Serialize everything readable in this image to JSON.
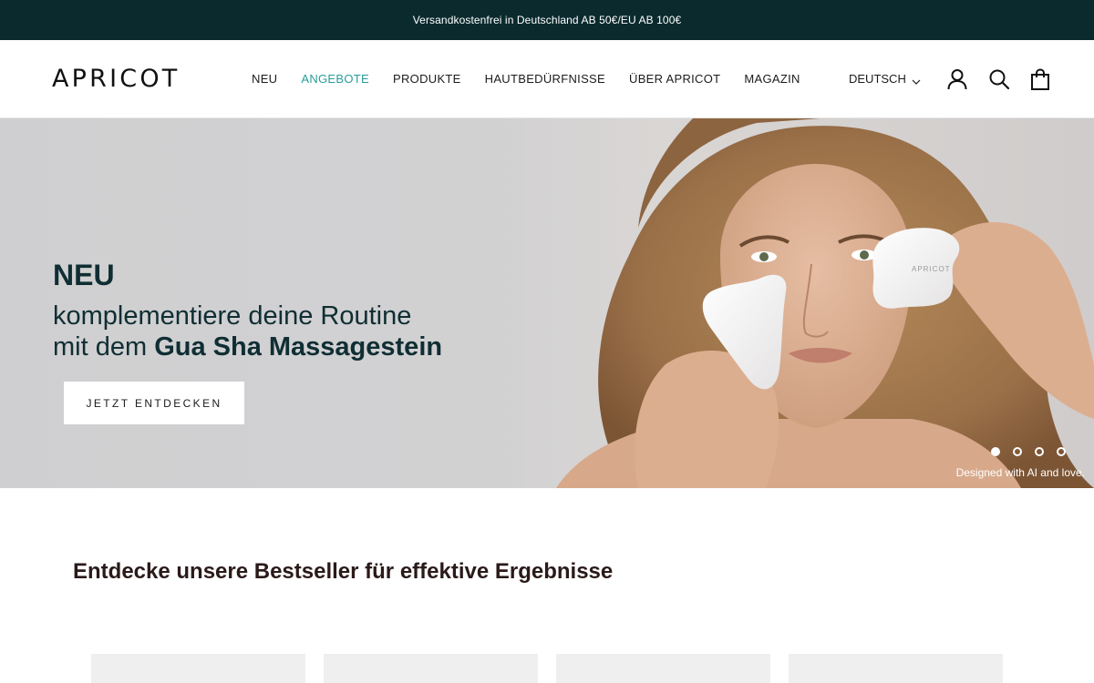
{
  "announcement": {
    "text": "Versandkostenfrei in Deutschland AB 50€/EU AB 100€"
  },
  "header": {
    "logo": "APRICOT",
    "nav": [
      {
        "label": "NEU",
        "active": false
      },
      {
        "label": "ANGEBOTE",
        "active": true
      },
      {
        "label": "PRODUKTE",
        "active": false
      },
      {
        "label": "HAUTBEDÜRFNISSE",
        "active": false
      },
      {
        "label": "ÜBER APRICOT",
        "active": false
      },
      {
        "label": "MAGAZIN",
        "active": false
      }
    ],
    "language": "DEUTSCH",
    "icons": [
      "account-icon",
      "search-icon",
      "bag-icon"
    ]
  },
  "hero": {
    "eyebrow": "NEU",
    "line1": "komplementiere deine Routine",
    "line2_prefix": "mit dem ",
    "line2_bold": "Gua Sha Massagestein",
    "cta": "JETZT ENTDECKEN",
    "stone_brand": "APRICOT",
    "caption": "Designed with AI and love.",
    "slides": 4,
    "active_slide": 1
  },
  "bestsellers": {
    "title": "Entdecke unsere Bestseller für effektive Ergebnisse"
  },
  "colors": {
    "announcement_bg": "#0a2a2e",
    "accent": "#2a9d9b",
    "heading": "#0f2e33"
  }
}
